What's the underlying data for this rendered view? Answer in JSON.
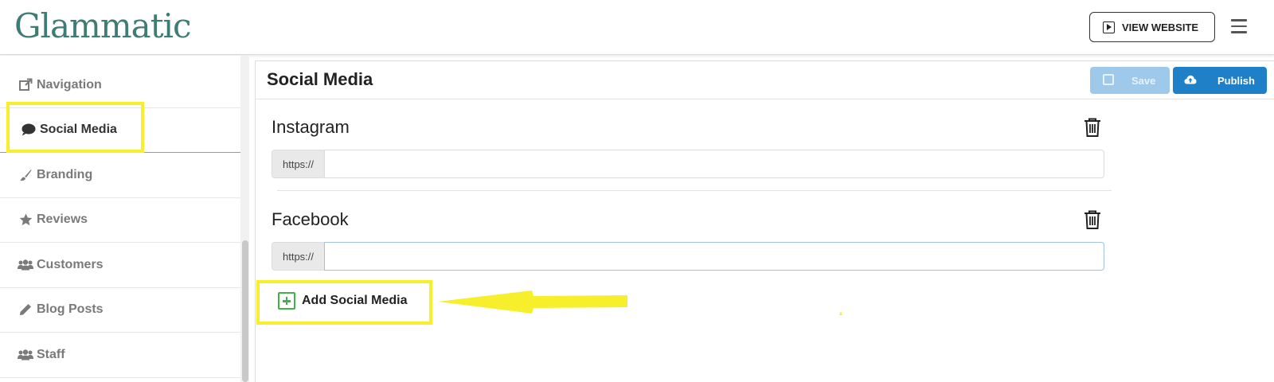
{
  "header": {
    "logo_text": "Glammatic",
    "view_website_label": "VIEW WEBSITE"
  },
  "sidebar": {
    "items": [
      {
        "label": "Navigation",
        "icon": "external-link-icon"
      },
      {
        "label": "Social Media",
        "icon": "comment-icon",
        "active": true
      },
      {
        "label": "Branding",
        "icon": "paintbrush-icon"
      },
      {
        "label": "Reviews",
        "icon": "star-icon"
      },
      {
        "label": "Customers",
        "icon": "users-icon"
      },
      {
        "label": "Blog Posts",
        "icon": "pencil-icon"
      },
      {
        "label": "Staff",
        "icon": "users-icon"
      }
    ]
  },
  "panel": {
    "title": "Social Media",
    "save_label": "Save",
    "publish_label": "Publish",
    "entries": [
      {
        "name": "Instagram",
        "prefix": "https://",
        "value": ""
      },
      {
        "name": "Facebook",
        "prefix": "https://",
        "value": ""
      }
    ],
    "add_label": "Add Social Media"
  },
  "colors": {
    "brand": "#3f7c73",
    "primary": "#1f7fc7",
    "save_disabled": "#9ec9ea",
    "add_green": "#3cb44b",
    "annotation_yellow": "#f7ef2b"
  }
}
